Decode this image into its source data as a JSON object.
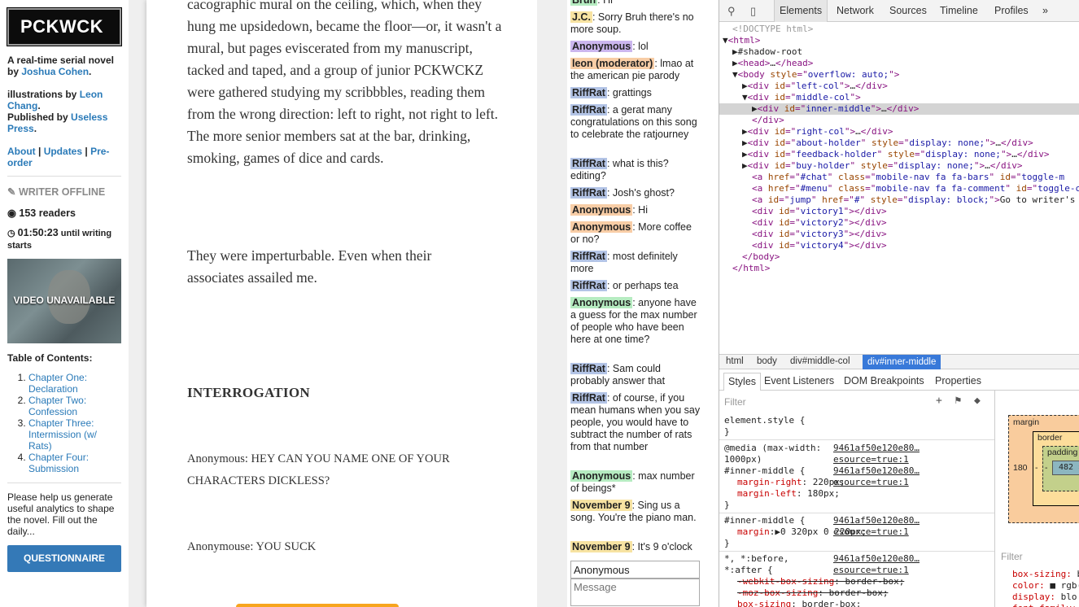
{
  "left": {
    "logo": "PCKWCK",
    "tagline": "A real-time serial novel by",
    "author": "Joshua Cohen",
    "illus_prefix": "illustrations by",
    "illustrator": "Leon Chang",
    "published_prefix": "Published by",
    "publisher": "Useless Press",
    "nav": [
      "About",
      "Updates",
      "Pre-order"
    ],
    "status": "WRITER OFFLINE",
    "readers": "153 readers",
    "timer_value": "01:50:23",
    "timer_suffix": "until writing starts",
    "video_text": "VIDEO UNAVAILABLE",
    "toc_title": "Table of Contents:",
    "toc": [
      "Chapter One: Declaration",
      "Chapter Two: Confession",
      "Chapter Three: Intermission (w/ Rats)",
      "Chapter Four: Submission"
    ],
    "help_text": "Please help us generate useful analytics to shape the novel. Fill out the daily...",
    "questionnaire": "QUESTIONNAIRE"
  },
  "story": {
    "p1": "cacographic mural on the ceiling, which, when they hung me upsidedown, became the floor—or, it wasn't a mural, but pages eviscerated from my manuscript, tacked and taped, and a group of junior PCKWCKZ were gathered  studying my scribbbles, reading them from the wrong direction: left to right, not right to left. The more senior members sat at the bar, drinking, smoking, games of dice and cards.",
    "p2": "They were imperturbable. Even when their associates assailed me.",
    "heading": "INTERROGATION",
    "q1": "Anonymous: HEY CAN YOU NAME ONE OF YOUR CHARACTERS DICKLESS?",
    "q2": "Anonymouse: YOU SUCK"
  },
  "chat": {
    "messages": [
      {
        "name": "Bruh",
        "text": ": Hi",
        "color": "green"
      },
      {
        "name": "J.C.",
        "text": ": Sorry Bruh there's no more soup.",
        "color": "yellow"
      },
      {
        "name": "Anonymous",
        "text": ": lol",
        "color": "purple"
      },
      {
        "name": "leon (moderator)",
        "text": ": lmao at the american pie parody",
        "color": "orange"
      },
      {
        "name": "RiffRat",
        "text": ": grattings",
        "color": "blue"
      },
      {
        "name": "RiffRat",
        "text": ": a gerat many congratulations on this song to celebrate the ratjourney",
        "color": "blue"
      },
      {
        "name": "RiffRat",
        "text": ": what is this? editing?",
        "color": "blue"
      },
      {
        "name": "RiffRat",
        "text": ": Josh's ghost?",
        "color": "blue"
      },
      {
        "name": "Anonymous",
        "text": ": Hi",
        "color": "orange"
      },
      {
        "name": "Anonymous",
        "text": ": More coffee or no?",
        "color": "orange"
      },
      {
        "name": "RiffRat",
        "text": ": most definitely more",
        "color": "blue"
      },
      {
        "name": "RiffRat",
        "text": ": or perhaps tea",
        "color": "blue"
      },
      {
        "name": "Anonymous",
        "text": ": anyone have a guess for the max number of people who have been here at one time?",
        "color": "green"
      },
      {
        "name": "RiffRat",
        "text": ": Sam could probably answer that",
        "color": "blue"
      },
      {
        "name": "RiffRat",
        "text": ": of course, if you mean humans when you say people, you would have to subtract the number of rats from that number",
        "color": "blue"
      },
      {
        "name": "Anonymous",
        "text": ": max number of beings*",
        "color": "green"
      },
      {
        "name": "November 9",
        "text": ": Sing us a song. You're the piano man.",
        "color": "yellow"
      },
      {
        "name": "November 9",
        "text": ": It's 9 o'clock",
        "color": "yellow"
      }
    ],
    "name_value": "Anonymous",
    "message_placeholder": "Message"
  },
  "devtools": {
    "tabs": [
      "Elements",
      "Network",
      "Sources",
      "Timeline",
      "Profiles"
    ],
    "more": "»",
    "crumbs": [
      "html",
      "body",
      "div#middle-col",
      "div#inner-middle"
    ],
    "subtabs": [
      "Styles",
      "Event Listeners",
      "DOM Breakpoints",
      "Properties"
    ],
    "filter": "Filter",
    "box_labels": {
      "margin": "margin",
      "border": "border",
      "padding": "padding",
      "content": "482 ×",
      "left": "180",
      "dash": "-",
      "dash2": "-"
    }
  }
}
